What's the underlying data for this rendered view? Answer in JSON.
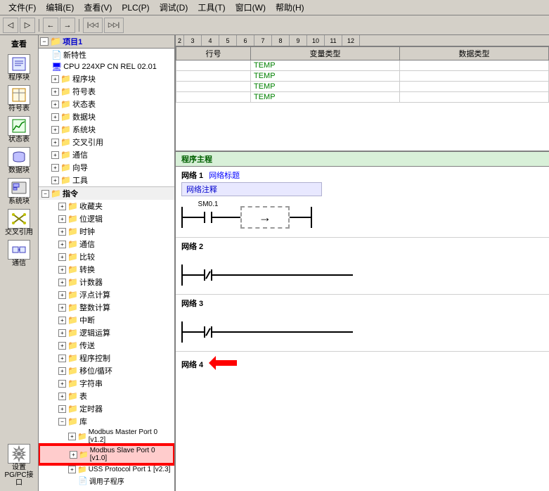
{
  "menubar": {
    "items": [
      "文件(F)",
      "编辑(E)",
      "查看(V)",
      "PLC(P)",
      "调试(D)",
      "工具(T)",
      "窗口(W)",
      "帮助(H)"
    ]
  },
  "toolbar": {
    "buttons": [
      "◁",
      "▷",
      "←",
      "→",
      "| ◁",
      "◁ |"
    ]
  },
  "sidebar": {
    "label": "查看",
    "items": [
      {
        "id": "chengxukuai",
        "label": "程序块",
        "icon": "📋"
      },
      {
        "id": "fuhubiao",
        "label": "符号表",
        "icon": "📊"
      },
      {
        "id": "zhuangtaibiao",
        "label": "状态表",
        "icon": "📈"
      },
      {
        "id": "shujukuai",
        "label": "数据块",
        "icon": "🗃"
      },
      {
        "id": "xitongkuai",
        "label": "系统块",
        "icon": "⚙"
      },
      {
        "id": "jiaochayinyong",
        "label": "交叉引用",
        "icon": "🔗"
      },
      {
        "id": "tongxin",
        "label": "通信",
        "icon": "📡"
      },
      {
        "id": "shezhi",
        "label": "设置PG/PC接口",
        "icon": "🔧"
      }
    ]
  },
  "tree": {
    "header": "查看",
    "root_label": "项目1",
    "items": [
      {
        "level": 1,
        "label": "新特性",
        "expandable": false,
        "icon": "doc"
      },
      {
        "level": 1,
        "label": "CPU 224XP CN REL 02.01",
        "expandable": false,
        "icon": "cpu"
      },
      {
        "level": 1,
        "label": "程序块",
        "expandable": true,
        "icon": "folder"
      },
      {
        "level": 1,
        "label": "符号表",
        "expandable": true,
        "icon": "folder"
      },
      {
        "level": 1,
        "label": "状态表",
        "expandable": true,
        "icon": "folder"
      },
      {
        "level": 1,
        "label": "数据块",
        "expandable": true,
        "icon": "folder"
      },
      {
        "level": 1,
        "label": "系统块",
        "expandable": true,
        "icon": "folder"
      },
      {
        "level": 1,
        "label": "交叉引用",
        "expandable": true,
        "icon": "folder"
      },
      {
        "level": 1,
        "label": "通信",
        "expandable": true,
        "icon": "folder"
      },
      {
        "level": 1,
        "label": "向导",
        "expandable": true,
        "icon": "folder"
      },
      {
        "level": 1,
        "label": "工具",
        "expandable": true,
        "icon": "folder"
      },
      {
        "level": 1,
        "label": "指令",
        "expandable": true,
        "icon": "folder",
        "section": true
      },
      {
        "level": 2,
        "label": "收藏夹",
        "expandable": true,
        "icon": "folder"
      },
      {
        "level": 2,
        "label": "位逻辑",
        "expandable": true,
        "icon": "folder"
      },
      {
        "level": 2,
        "label": "时钟",
        "expandable": true,
        "icon": "folder"
      },
      {
        "level": 2,
        "label": "通信",
        "expandable": true,
        "icon": "folder"
      },
      {
        "level": 2,
        "label": "比较",
        "expandable": true,
        "icon": "folder"
      },
      {
        "level": 2,
        "label": "转换",
        "expandable": true,
        "icon": "folder"
      },
      {
        "level": 2,
        "label": "计数器",
        "expandable": true,
        "icon": "folder"
      },
      {
        "level": 2,
        "label": "浮点计算",
        "expandable": true,
        "icon": "folder"
      },
      {
        "level": 2,
        "label": "整数计算",
        "expandable": true,
        "icon": "folder"
      },
      {
        "level": 2,
        "label": "中断",
        "expandable": true,
        "icon": "folder"
      },
      {
        "level": 2,
        "label": "逻辑运算",
        "expandable": true,
        "icon": "folder"
      },
      {
        "level": 2,
        "label": "传送",
        "expandable": true,
        "icon": "folder"
      },
      {
        "level": 2,
        "label": "程序控制",
        "expandable": true,
        "icon": "folder"
      },
      {
        "level": 2,
        "label": "移位/循环",
        "expandable": true,
        "icon": "folder"
      },
      {
        "level": 2,
        "label": "字符串",
        "expandable": true,
        "icon": "folder"
      },
      {
        "level": 2,
        "label": "表",
        "expandable": true,
        "icon": "folder"
      },
      {
        "level": 2,
        "label": "定时器",
        "expandable": true,
        "icon": "folder"
      },
      {
        "level": 2,
        "label": "库",
        "expandable": true,
        "icon": "folder"
      },
      {
        "level": 3,
        "label": "Modbus Master Port 0 [v1.2]",
        "expandable": true,
        "icon": "folder",
        "highlighted": false
      },
      {
        "level": 3,
        "label": "Modbus Slave Port 0 [v1.0]",
        "expandable": true,
        "icon": "folder",
        "highlighted": true
      },
      {
        "level": 3,
        "label": "USS Protocol Port 1 [v2.3]",
        "expandable": true,
        "icon": "folder",
        "highlighted": false
      },
      {
        "level": 3,
        "label": "调用子程序",
        "expandable": false,
        "icon": "doc"
      }
    ]
  },
  "var_table": {
    "columns": [
      "行号",
      "变量类型",
      "数据类型"
    ],
    "rows": [
      {
        "num": "",
        "var_type": "TEMP",
        "data_type": ""
      },
      {
        "num": "",
        "var_type": "TEMP",
        "data_type": ""
      },
      {
        "num": "",
        "var_type": "TEMP",
        "data_type": ""
      },
      {
        "num": "",
        "var_type": "TEMP",
        "data_type": ""
      }
    ]
  },
  "ruler": {
    "numbers": [
      "2",
      "3",
      "4",
      "5",
      "6",
      "7",
      "8",
      "9",
      "10",
      "11",
      "12"
    ]
  },
  "program": {
    "header": "程序主程",
    "networks": [
      {
        "id": 1,
        "label": "网络 1",
        "title": "网络标题",
        "comment": "网络注释",
        "has_ladder": true,
        "contact": "SM0.1"
      },
      {
        "id": 2,
        "label": "网络 2",
        "has_ladder": true,
        "contact": null
      },
      {
        "id": 3,
        "label": "网络 3",
        "has_ladder": true,
        "contact": null
      },
      {
        "id": 4,
        "label": "网络 4",
        "has_ladder": false,
        "contact": null
      }
    ]
  }
}
